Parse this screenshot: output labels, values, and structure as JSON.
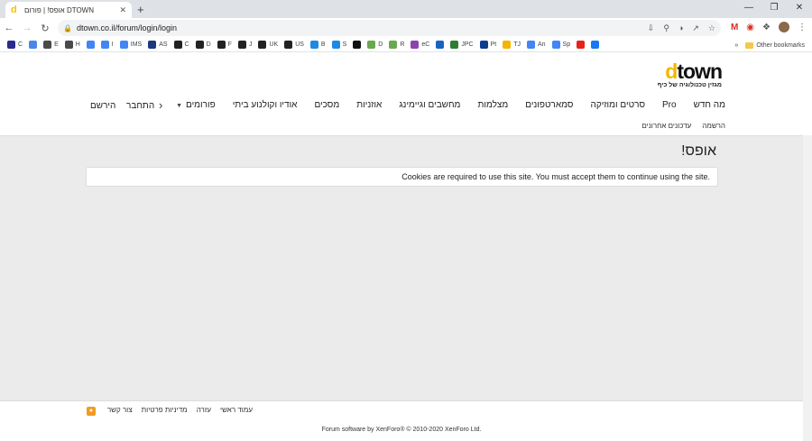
{
  "browser": {
    "tab_title": "אופס! | פורום DTOWN",
    "tab_close": "✕",
    "new_tab": "+",
    "url": "dtown.co.il/forum/login/login",
    "window_controls": [
      "—",
      "❐",
      "✕"
    ]
  },
  "bookmarks": [
    {
      "label": "C",
      "color": "#2b2b8f"
    },
    {
      "label": "",
      "color": "#4a86e8"
    },
    {
      "label": "E",
      "color": "#4a4a4a"
    },
    {
      "label": "H",
      "color": "#4a4a4a"
    },
    {
      "label": "",
      "color": "#4285f4"
    },
    {
      "label": "I",
      "color": "#4285f4"
    },
    {
      "label": "IMS",
      "color": "#4285f4"
    },
    {
      "label": "AS",
      "color": "#1a3a7a"
    },
    {
      "label": "C",
      "color": "#222222"
    },
    {
      "label": "D",
      "color": "#222222"
    },
    {
      "label": "F",
      "color": "#222222"
    },
    {
      "label": "J",
      "color": "#222222"
    },
    {
      "label": "UK",
      "color": "#222222"
    },
    {
      "label": "US",
      "color": "#222222"
    },
    {
      "label": "B",
      "color": "#1e88e5"
    },
    {
      "label": "S",
      "color": "#1e88e5"
    },
    {
      "label": "",
      "color": "#111111"
    },
    {
      "label": "D",
      "color": "#6aa84f"
    },
    {
      "label": "R",
      "color": "#6aa84f"
    },
    {
      "label": "eC",
      "color": "#8e44ad"
    },
    {
      "label": "",
      "color": "#1565c0"
    },
    {
      "label": "JPC",
      "color": "#2e7d32"
    },
    {
      "label": "Pt",
      "color": "#0b3d91"
    },
    {
      "label": "TJ",
      "color": "#f4b400"
    },
    {
      "label": "An",
      "color": "#4285f4"
    },
    {
      "label": "Sp",
      "color": "#4285f4"
    },
    {
      "label": "",
      "color": "#e62117"
    },
    {
      "label": "",
      "color": "#1877f2"
    }
  ],
  "bookmarks_more": "»",
  "other_bookmarks": "Other bookmarks",
  "site": {
    "logo_word_first": "d",
    "logo_word_rest": "town",
    "logo_tagline": "מגזין טכנולוגיה של כיף",
    "nav": [
      "פורומים",
      "אודיו וקולנוע ביתי",
      "מסכים",
      "אוזניות",
      "מחשבים וגיימינג",
      "מצלמות",
      "סמארטפונים",
      "סרטים ומוזיקה",
      "Pro",
      "מה חדש"
    ],
    "login": "התחבר",
    "register": "הירשם",
    "subnav": [
      "עדכונים אחרונים",
      "הרשמה"
    ],
    "error_title": "אופס!",
    "error_message": "Cookies are required to use this site. You must accept them to continue using the site.",
    "footer_links": [
      "צור קשר",
      "מדיניות פרטיות",
      "עזרה",
      "עמוד ראשי"
    ],
    "credit": "Forum software by XenForo® © 2010-2020 XenForo Ltd."
  }
}
